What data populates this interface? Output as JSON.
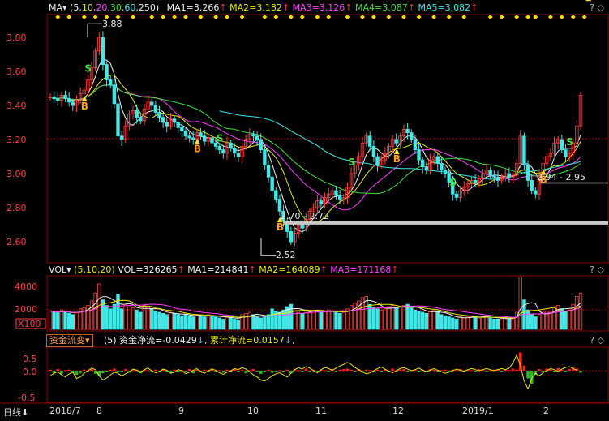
{
  "price_panel": {
    "indicator": "MA",
    "params_open": "(",
    "params": [
      "5",
      "10",
      "20",
      "30",
      "60",
      "250"
    ],
    "params_close": ")",
    "ma_values": [
      {
        "label": "MA1=3.266",
        "color": "#f0f0f0"
      },
      {
        "label": "MA2=3.182",
        "color": "#e8e800"
      },
      {
        "label": "MA3=3.126",
        "color": "#ff40ff"
      },
      {
        "label": "MA4=3.087",
        "color": "#40e040"
      },
      {
        "label": "MA5=3.082",
        "color": "#40e8e8"
      }
    ],
    "y_ticks": [
      "3.80",
      "3.60",
      "3.40",
      "3.20",
      "3.00",
      "2.80",
      "2.60"
    ],
    "annotations": {
      "high": "3.88",
      "low": "2.52",
      "range_1": "2.70 - 2.72",
      "range_2": "2.94 - 2.95"
    }
  },
  "volume_panel": {
    "indicator": "VOL",
    "params": "(5,10,20)",
    "vol": "VOL=326265",
    "ma_values": [
      {
        "label": "MA1=214841",
        "color": "#f0f0f0"
      },
      {
        "label": "MA2=164089",
        "color": "#e8e800"
      },
      {
        "label": "MA3=171168",
        "color": "#ff40ff"
      }
    ],
    "y_ticks": [
      "4000",
      "2000"
    ],
    "unit": "X100"
  },
  "fund_panel": {
    "indicator": "资金流变",
    "params": "(5)",
    "net": "资金净流=-0.0429",
    "cumulative": "累计净流=0.0157",
    "y_ticks": [
      "0.5",
      "0.0",
      "-0.5"
    ]
  },
  "bottom_axis": {
    "period": "日线",
    "dates": [
      "2018/7",
      "8",
      "9",
      "10",
      "11",
      "12",
      "2019/1",
      "2"
    ]
  },
  "icons": {
    "help": "?",
    "close": "◇"
  },
  "colors": {
    "up": "#ff4040",
    "down": "#40e8e8",
    "grid": "#8b0000",
    "signal_b": "#ffa020",
    "signal_s": "#40e040",
    "diamond": "#ffd700",
    "fund_in": "#ff2020",
    "fund_out": "#20c020",
    "fund_line": "#e8e800"
  },
  "chart_data": {
    "type": "candlestick",
    "x_start": "2018-07",
    "x_end": "2019-02",
    "ylim": [
      2.45,
      3.95
    ],
    "close": [
      3.45,
      3.44,
      3.43,
      3.46,
      3.44,
      3.42,
      3.4,
      3.43,
      3.47,
      3.49,
      3.55,
      3.62,
      3.72,
      3.8,
      3.64,
      3.55,
      3.52,
      3.41,
      3.22,
      3.2,
      3.28,
      3.35,
      3.37,
      3.33,
      3.31,
      3.38,
      3.42,
      3.4,
      3.36,
      3.33,
      3.3,
      3.28,
      3.32,
      3.3,
      3.27,
      3.25,
      3.22,
      3.21,
      3.2,
      3.24,
      3.22,
      3.19,
      3.21,
      3.18,
      3.16,
      3.14,
      3.12,
      3.18,
      3.15,
      3.12,
      3.1,
      3.16,
      3.2,
      3.23,
      3.22,
      3.2,
      3.14,
      3.05,
      2.98,
      2.9,
      2.85,
      2.78,
      2.72,
      2.66,
      2.6,
      2.65,
      2.7,
      2.68,
      2.73,
      2.78,
      2.8,
      2.84,
      2.82,
      2.86,
      2.88,
      2.9,
      2.87,
      2.85,
      2.86,
      2.92,
      3.0,
      3.05,
      3.1,
      3.18,
      3.22,
      3.16,
      3.1,
      3.05,
      3.08,
      3.12,
      3.16,
      3.2,
      3.18,
      3.22,
      3.26,
      3.24,
      3.2,
      3.14,
      3.08,
      3.04,
      3.02,
      3.08,
      3.1,
      3.06,
      3.02,
      3.0,
      2.95,
      2.88,
      2.86,
      2.9,
      2.92,
      2.94,
      2.96,
      2.95,
      2.97,
      3.0,
      3.02,
      2.99,
      2.98,
      2.96,
      2.98,
      3.0,
      2.98,
      2.99,
      3.06,
      3.22,
      3.05,
      2.96,
      2.9,
      2.88,
      3.0,
      3.06,
      3.1,
      3.12,
      3.18,
      3.2,
      3.14,
      3.1,
      3.12,
      3.18,
      3.28,
      3.46
    ],
    "volume": [
      1600,
      1500,
      1450,
      1700,
      1500,
      1400,
      1300,
      1500,
      1800,
      1900,
      2100,
      2500,
      3200,
      4000,
      2600,
      2100,
      1800,
      2200,
      3100,
      1800,
      2200,
      2000,
      1900,
      1700,
      1500,
      2100,
      2000,
      1800,
      1600,
      1500,
      1400,
      1300,
      1500,
      1400,
      1300,
      1200,
      1300,
      1200,
      1100,
      1300,
      1200,
      1100,
      1300,
      1200,
      1100,
      1000,
      900,
      1200,
      1000,
      900,
      850,
      1300,
      1400,
      1500,
      1300,
      1200,
      1000,
      1100,
      1300,
      1800,
      1600,
      1500,
      1700,
      2000,
      2200,
      1700,
      1500,
      1400,
      1500,
      1600,
      1500,
      1700,
      1500,
      1600,
      1700,
      1600,
      1500,
      1400,
      1500,
      1800,
      2100,
      2300,
      2500,
      2800,
      2900,
      2200,
      1900,
      1800,
      1700,
      1800,
      2000,
      2100,
      1900,
      2000,
      2100,
      2200,
      1900,
      1700,
      1600,
      1500,
      1400,
      1600,
      1700,
      1500,
      1300,
      1200,
      1100,
      1000,
      900,
      1100,
      1000,
      1100,
      1200,
      1100,
      1000,
      1100,
      1200,
      1000,
      900,
      900,
      950,
      1000,
      950,
      1000,
      1500,
      4600,
      2600,
      1700,
      1300,
      1100,
      1300,
      1500,
      1600,
      1500,
      2000,
      2100,
      1800,
      1600,
      1700,
      2200,
      2900,
      3200
    ],
    "fund_flow": [
      0.02,
      -0.05,
      0.03,
      -0.06,
      0.01,
      0.02,
      -0.04,
      -0.08,
      -0.05,
      0.02,
      -0.02,
      0.03,
      -0.06,
      -0.1,
      -0.05,
      -0.03,
      0.02,
      0.04,
      -0.03,
      -0.02,
      0.03,
      -0.04,
      0.01,
      0.02,
      -0.05,
      0.02,
      0.01,
      -0.03,
      0.02,
      -0.02,
      0.03,
      -0.01,
      -0.04,
      0.02,
      -0.03,
      0.01,
      -0.02,
      0.03,
      -0.05,
      0.02,
      -0.01,
      0.02,
      -0.03,
      0.04,
      -0.02,
      0.01,
      -0.04,
      0.02,
      -0.01,
      0.03,
      -0.02,
      0.02,
      -0.05,
      0.01,
      0.03,
      -0.02,
      -0.06,
      -0.03,
      0.02,
      -0.04,
      -0.02,
      0.01,
      -0.03,
      0.02,
      -0.05,
      0.03,
      0.01,
      -0.02,
      0.04,
      -0.01,
      0.02,
      -0.03,
      0.02,
      0.01,
      -0.02,
      0.03,
      -0.01,
      0.02,
      0.03,
      0.04,
      0.02,
      -0.02,
      0.03,
      -0.04,
      0.02,
      0.01,
      -0.03,
      0.02,
      -0.01,
      0.03,
      -0.02,
      0.04,
      -0.01,
      0.02,
      0.03,
      -0.02,
      0.01,
      0.02,
      -0.03,
      0.02,
      -0.01,
      0.03,
      0.02,
      -0.02,
      0.01,
      0.02,
      -0.03,
      0.02,
      0.01,
      0.03,
      -0.02,
      0.02,
      0.01,
      -0.01,
      0.03,
      0.02,
      -0.02,
      0.01,
      0.02,
      0.03,
      -0.01,
      0.02,
      0.01,
      0.04,
      0.02,
      0.35,
      0.1,
      -0.15,
      -0.25,
      -0.08,
      0.03,
      -0.02,
      0.04,
      0.02,
      -0.03,
      0.05,
      0.02,
      -0.02,
      0.03,
      0.06,
      0.04,
      -0.04
    ],
    "fund_line": [
      -0.1,
      -0.05,
      -0.02,
      -0.08,
      -0.12,
      -0.06,
      -0.03,
      -0.15,
      -0.12,
      -0.05,
      0.0,
      0.05,
      0.02,
      -0.1,
      -0.18,
      -0.14,
      -0.08,
      -0.03,
      -0.05,
      -0.1,
      -0.06,
      -0.02,
      0.03,
      0.01,
      -0.03,
      0.02,
      0.05,
      0.0,
      -0.04,
      -0.02,
      0.03,
      0.01,
      -0.05,
      -0.03,
      0.02,
      0.0,
      -0.06,
      -0.03,
      0.01,
      0.04,
      -0.02,
      -0.05,
      0.0,
      0.03,
      0.01,
      -0.04,
      -0.07,
      -0.03,
      0.0,
      0.04,
      0.02,
      0.06,
      0.03,
      -0.02,
      -0.08,
      -0.12,
      -0.18,
      -0.2,
      -0.15,
      -0.1,
      -0.06,
      -0.04,
      -0.08,
      -0.12,
      -0.05,
      0.02,
      0.06,
      0.03,
      0.08,
      0.05,
      0.0,
      -0.04,
      0.02,
      0.06,
      0.04,
      0.01,
      0.05,
      0.09,
      0.12,
      0.16,
      0.12,
      0.06,
      0.02,
      -0.02,
      -0.06,
      -0.04,
      0.0,
      0.04,
      0.07,
      0.03,
      -0.01,
      -0.04,
      0.0,
      0.04,
      0.06,
      0.03,
      0.0,
      0.02,
      0.05,
      0.01,
      -0.02,
      0.01,
      0.04,
      0.01,
      -0.02,
      -0.05,
      -0.03,
      0.0,
      0.03,
      0.01,
      -0.01,
      0.02,
      0.04,
      0.02,
      0.0,
      0.02,
      0.04,
      0.02,
      0.0,
      0.02,
      0.04,
      0.02,
      0.05,
      0.15,
      0.3,
      0.1,
      -0.2,
      -0.35,
      -0.15,
      -0.05,
      -0.1,
      -0.04,
      0.0,
      0.04,
      0.02,
      -0.02,
      0.03,
      0.06,
      0.08,
      0.04,
      0.01
    ],
    "b_signals": [
      9,
      39,
      61,
      92,
      131,
      143
    ],
    "s_signals": [
      10,
      45,
      80,
      107,
      138
    ]
  }
}
